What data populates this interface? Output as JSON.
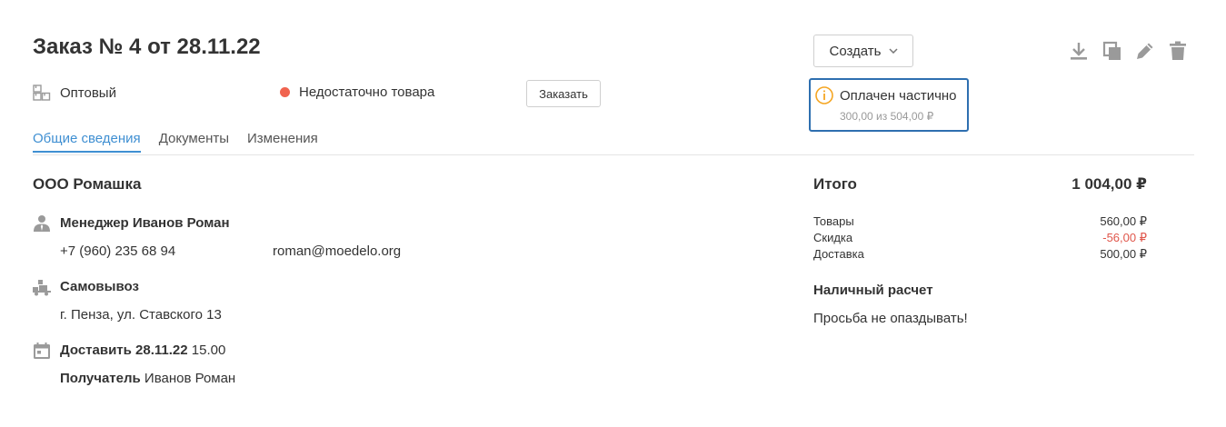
{
  "header": {
    "title": "Заказ № 4 от 28.11.22",
    "create_label": "Создать",
    "tools": [
      "download-icon",
      "copy-icon",
      "edit-icon",
      "trash-icon"
    ]
  },
  "status_row": {
    "type_label": "Оптовый",
    "stock_status": "Недостаточно товара",
    "stock_status_color": "#f0634f",
    "order_button_label": "Заказать"
  },
  "payment_status": {
    "label": "Оплачен частично",
    "detail": "300,00 из 504,00 ₽",
    "icon_color": "#f5a623",
    "border_color": "#2e6fb0"
  },
  "tabs": [
    {
      "label": "Общие сведения",
      "active": true
    },
    {
      "label": "Документы",
      "active": false
    },
    {
      "label": "Изменения",
      "active": false
    }
  ],
  "customer": {
    "company": "ООО Ромашка",
    "manager_label": "Менеджер Иванов Роман",
    "phone": "+7 (960) 235 68 94",
    "email": "roman@moedelo.org",
    "delivery_method": "Самовывоз",
    "address": "г. Пенза, ул. Ставского 13",
    "deliver_label": "Доставить 28.11.22",
    "deliver_time": "15.00",
    "recipient_label": "Получатель",
    "recipient_name": "Иванов Роман"
  },
  "summary": {
    "title": "Итого",
    "total": "1 004,00 ₽",
    "rows": [
      {
        "label": "Товары",
        "value": "560,00 ₽"
      },
      {
        "label": "Скидка",
        "value": "-56,00 ₽"
      },
      {
        "label": "Доставка",
        "value": "500,00 ₽"
      }
    ],
    "payment_method": "Наличный расчет",
    "comment": "Просьба не опаздывать!"
  },
  "colors": {
    "accent": "#3f8fd2",
    "negative": "#e0564b",
    "icon_gray": "#9a9a9a"
  }
}
